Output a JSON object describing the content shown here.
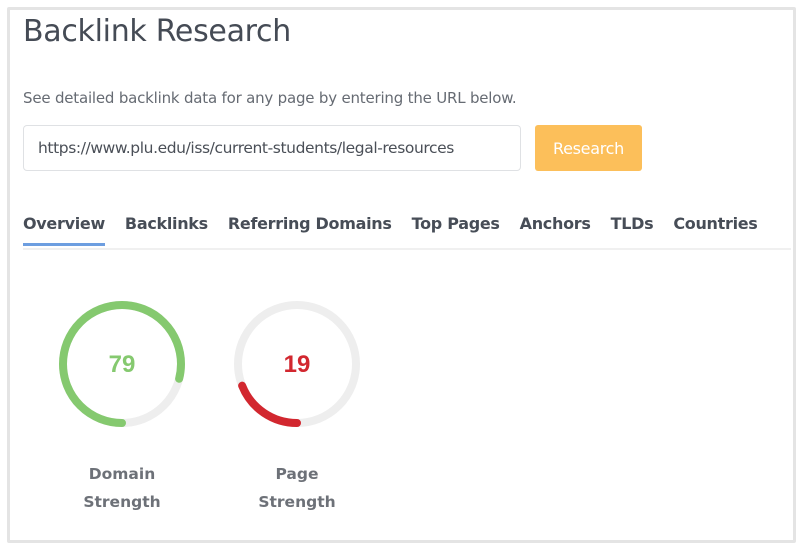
{
  "header": {
    "title": "Backlink Research",
    "description": "See detailed backlink data for any page by entering the URL below."
  },
  "search": {
    "value": "https://www.plu.edu/iss/current-students/legal-resources",
    "button_label": "Research",
    "button_color": "#fcbf5a"
  },
  "tabs": [
    {
      "label": "Overview",
      "active": true
    },
    {
      "label": "Backlinks"
    },
    {
      "label": "Referring Domains"
    },
    {
      "label": "Top Pages"
    },
    {
      "label": "Anchors"
    },
    {
      "label": "TLDs"
    },
    {
      "label": "Countries"
    }
  ],
  "metrics": [
    {
      "value": 79,
      "label_line1": "Domain",
      "label_line2": "Strength",
      "color": "#85c96f"
    },
    {
      "value": 19,
      "label_line1": "Page",
      "label_line2": "Strength",
      "color": "#d2272f"
    }
  ]
}
